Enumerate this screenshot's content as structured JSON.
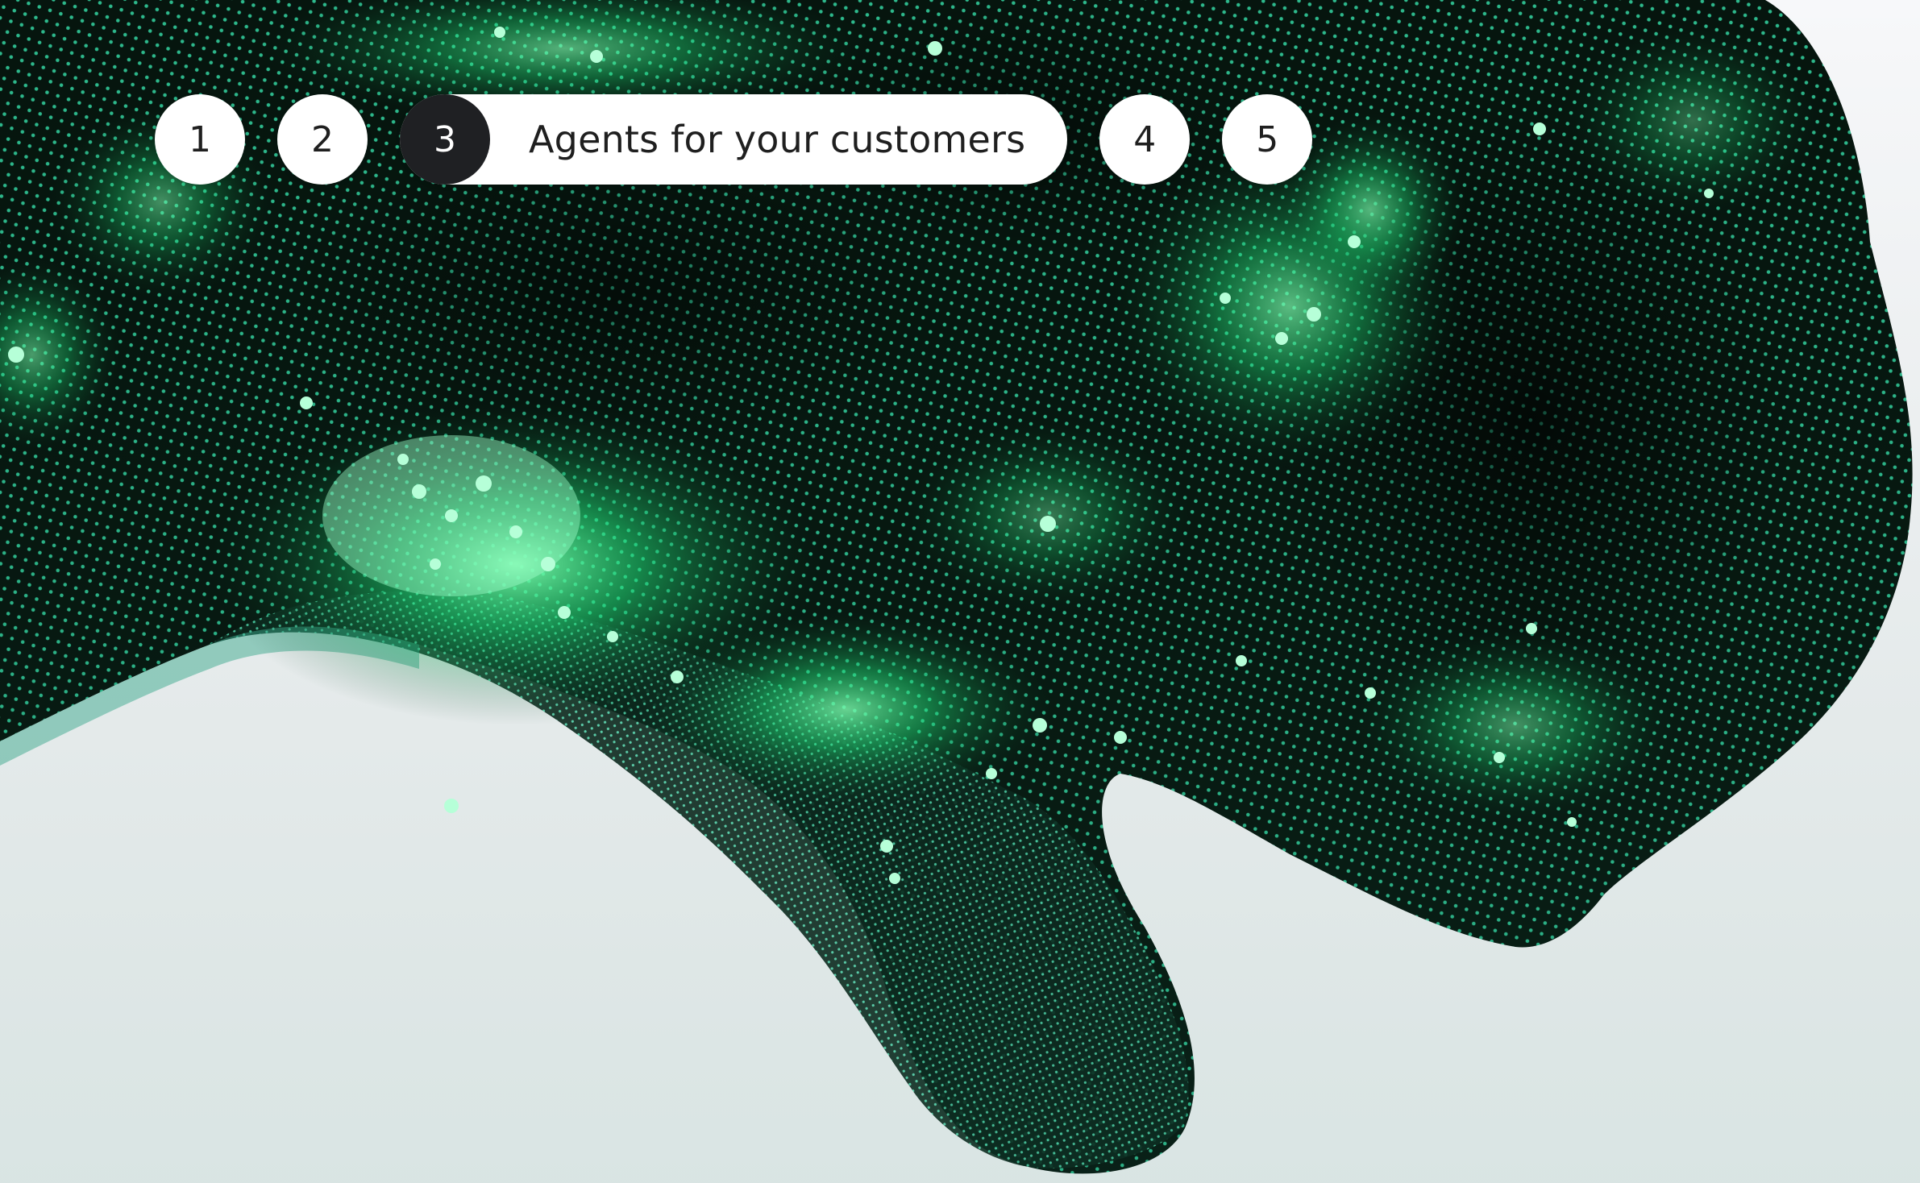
{
  "colors": {
    "background": "#f7f8fa",
    "particle_dark": "#05140d",
    "particle_glow": "#3dff9a",
    "particle_teal": "#2ec7a0",
    "active_step_bg": "#1f2023",
    "step_bg": "#ffffff"
  },
  "hero": {
    "art_icon": "green-particle-wave-art"
  },
  "stepper": {
    "steps": [
      {
        "number": "1"
      },
      {
        "number": "2"
      },
      {
        "number": "3",
        "label": "Agents for your customers"
      },
      {
        "number": "4"
      },
      {
        "number": "5"
      }
    ],
    "active_index": 2
  }
}
